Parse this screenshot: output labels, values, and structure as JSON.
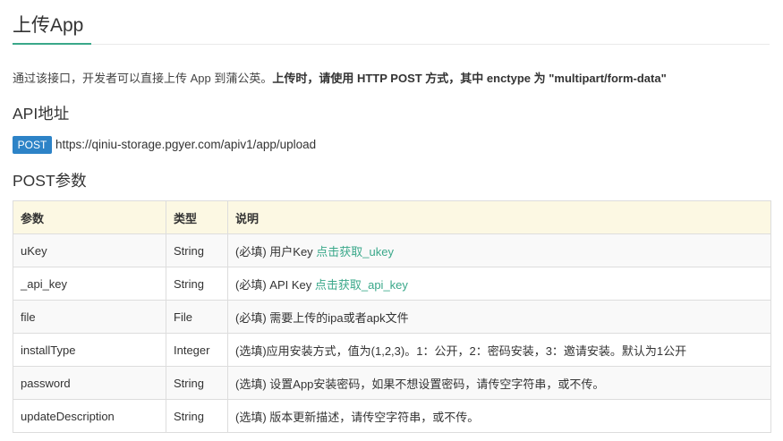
{
  "page": {
    "title": "上传App",
    "intro_normal": "通过该接口，开发者可以直接上传 App 到蒲公英。",
    "intro_bold": "上传时，请使用 HTTP POST 方式，其中 enctype 为 \"multipart/form-data\""
  },
  "api": {
    "heading": "API地址",
    "method": "POST",
    "url": "https://qiniu-storage.pgyer.com/apiv1/app/upload"
  },
  "params": {
    "heading": "POST参数",
    "headers": [
      "参数",
      "类型",
      "说明"
    ],
    "rows": [
      {
        "name": "uKey",
        "type": "String",
        "desc": "(必填) 用户Key ",
        "link": "点击获取_ukey"
      },
      {
        "name": "_api_key",
        "type": "String",
        "desc": "(必填) API Key ",
        "link": "点击获取_api_key"
      },
      {
        "name": "file",
        "type": "File",
        "desc": "(必填) 需要上传的ipa或者apk文件",
        "link": ""
      },
      {
        "name": "installType",
        "type": "Integer",
        "desc": "(选填)应用安装方式，值为(1,2,3)。1：公开，2：密码安装，3：邀请安装。默认为1公开",
        "link": ""
      },
      {
        "name": "password",
        "type": "String",
        "desc": "(选填) 设置App安装密码，如果不想设置密码，请传空字符串，或不传。",
        "link": ""
      },
      {
        "name": "updateDescription",
        "type": "String",
        "desc": "(选填) 版本更新描述，请传空字符串，或不传。",
        "link": ""
      }
    ]
  },
  "colors": {
    "accent": "#3aa88a",
    "badge": "#2d83c7",
    "header_bg": "#fcf8e3"
  }
}
